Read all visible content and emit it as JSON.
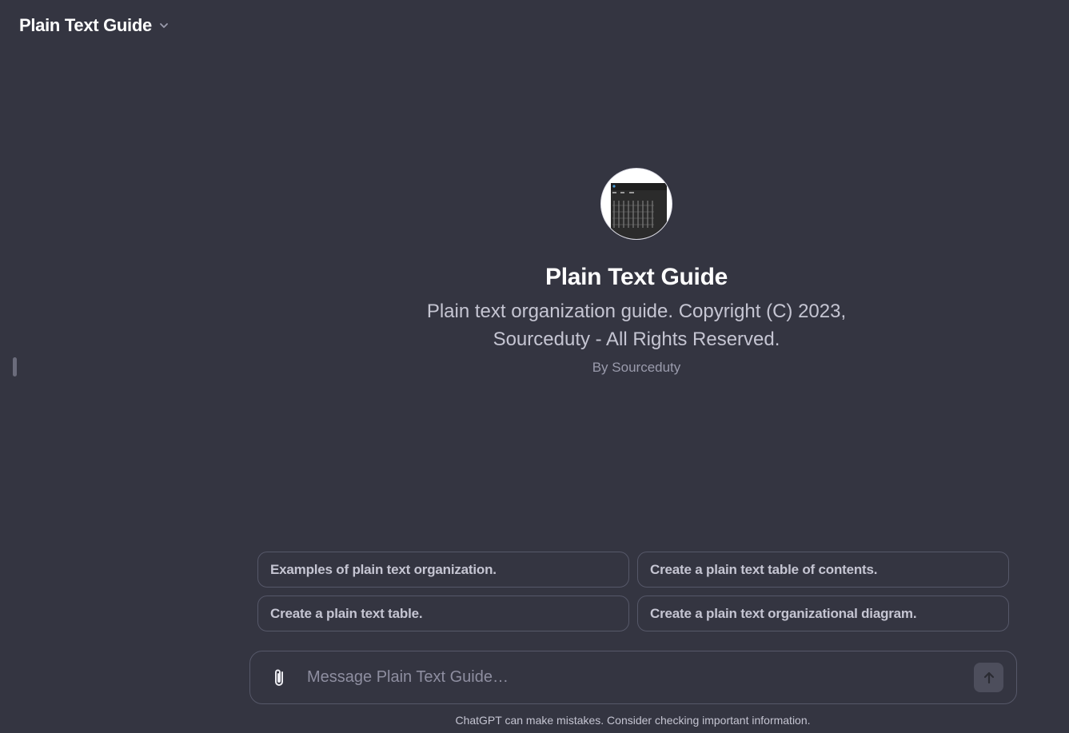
{
  "header": {
    "title": "Plain Text Guide",
    "dropdown_icon": "chevron-down-icon"
  },
  "gpt": {
    "name": "Plain Text Guide",
    "description": "Plain text organization guide. Copyright (C) 2023, Sourceduty - All Rights Reserved.",
    "author": "By Sourceduty"
  },
  "suggestions": [
    {
      "label": "Examples of plain text organization."
    },
    {
      "label": "Create a plain text table of contents."
    },
    {
      "label": "Create a plain text table."
    },
    {
      "label": "Create a plain text organizational diagram."
    }
  ],
  "composer": {
    "placeholder": "Message Plain Text Guide…",
    "attach_icon": "paperclip-icon",
    "send_icon": "arrow-up-icon"
  },
  "footer": {
    "disclaimer": "ChatGPT can make mistakes. Consider checking important information."
  },
  "colors": {
    "background": "#343541",
    "border": "#565869",
    "text": "#ececf1",
    "muted": "#9a9bac"
  }
}
